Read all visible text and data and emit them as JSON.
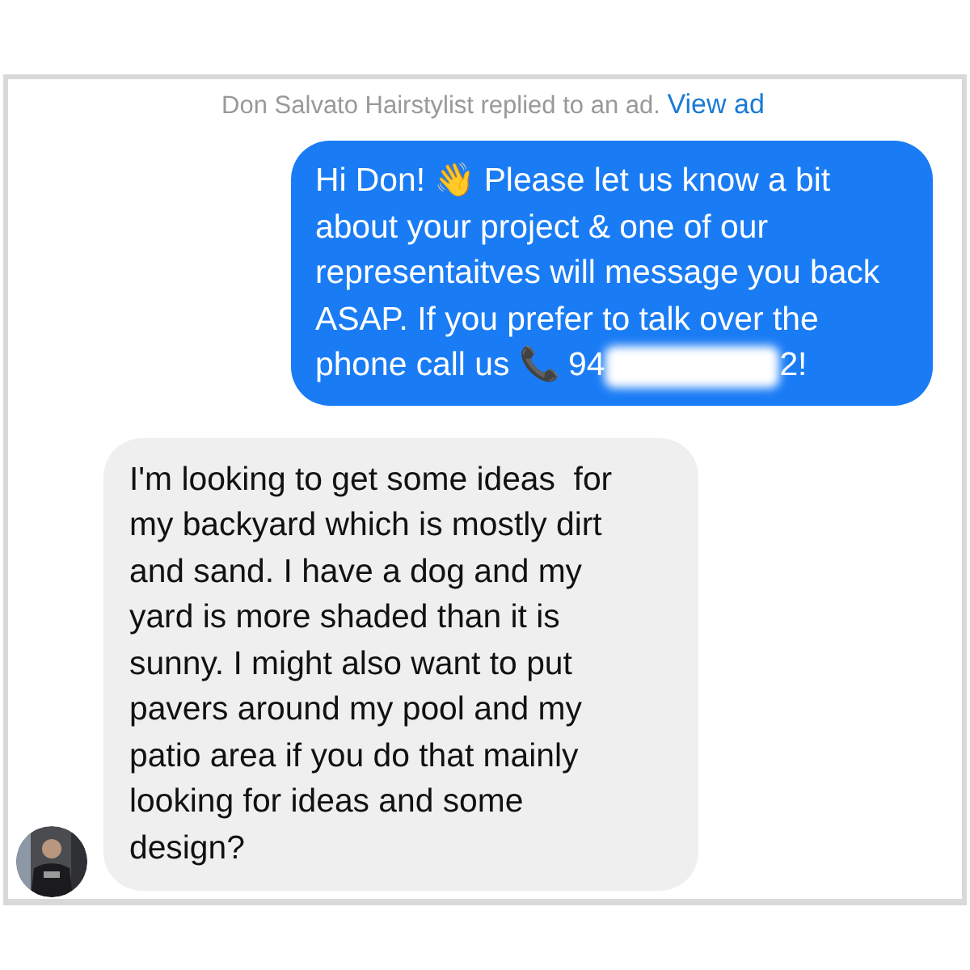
{
  "notice": {
    "text": "Don Salvato Hairstylist replied to an ad.",
    "link": "View ad"
  },
  "messages": [
    {
      "kind": "sent",
      "text_before_redaction": "Hi Don! 👋 Please let us know a bit about your project & one of our representaitves will message you back ASAP. If you prefer to talk over the phone call us 📞 94",
      "redacted": true,
      "text_after_redaction": "2!"
    },
    {
      "kind": "received",
      "text_before_redaction": "I'm looking to get some ideas  for my backyard which is mostly dirt and sand. I have a dog and my yard is more shaded than it is sunny. I might also want to put pavers around my pool and my patio area if you do that mainly looking for ideas and some design?",
      "avatar": true
    }
  ]
}
